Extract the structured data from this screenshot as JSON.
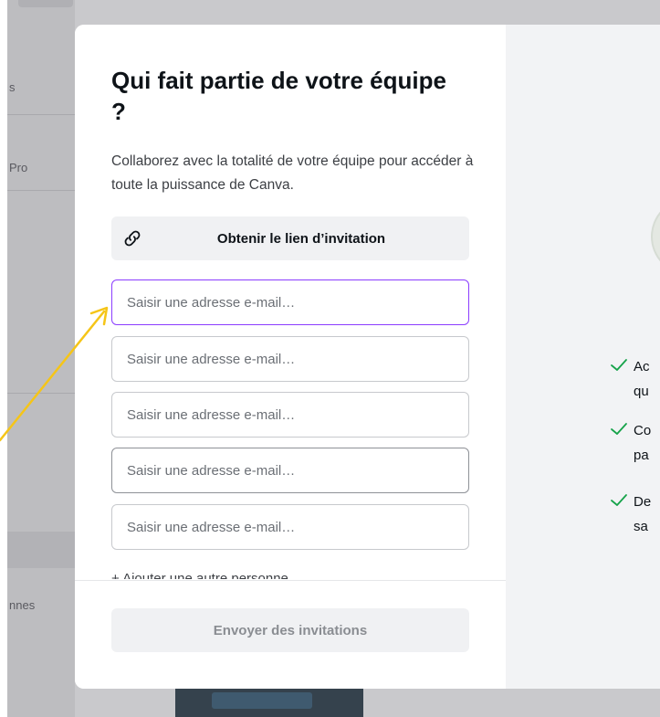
{
  "background": {
    "sidebar_snippets": [
      "s",
      "Pro",
      "nnes"
    ]
  },
  "modal": {
    "title": "Qui fait partie de votre équipe ?",
    "description": "Collaborez avec la totalité de votre équipe pour accéder à toute la puissance de Canva.",
    "invite_link_label": "Obtenir le lien d’invitation",
    "email_fields": [
      {
        "value": "",
        "placeholder": "Saisir une adresse e-mail…"
      },
      {
        "value": "",
        "placeholder": "Saisir une adresse e-mail…"
      },
      {
        "value": "",
        "placeholder": "Saisir une adresse e-mail…"
      },
      {
        "value": "",
        "placeholder": "Saisir une adresse e-mail…"
      },
      {
        "value": "",
        "placeholder": "Saisir une adresse e-mail…"
      }
    ],
    "add_person_label": "+ Ajouter une autre personne",
    "send_button_label": "Envoyer des invitations",
    "benefits": [
      {
        "line1": "Ac",
        "line2": "qu"
      },
      {
        "line1": "Co",
        "line2": "pa"
      },
      {
        "line1": "De",
        "line2": "sa"
      }
    ]
  },
  "colors": {
    "accent_focus": "#8b3dff",
    "check_green": "#16a34a",
    "annotation_arrow": "#f5c518"
  }
}
